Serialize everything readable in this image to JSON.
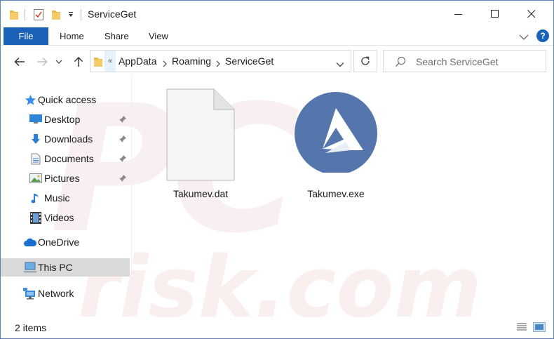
{
  "window": {
    "title": "ServiceGet",
    "accent": "#1a62b8"
  },
  "ribbon": {
    "file_label": "File",
    "tabs": [
      "Home",
      "Share",
      "View"
    ]
  },
  "address": {
    "overflow_marker": "«",
    "crumbs": [
      "AppData",
      "Roaming",
      "ServiceGet"
    ]
  },
  "search": {
    "placeholder": "Search ServiceGet"
  },
  "sidebar": {
    "quick_access": "Quick access",
    "items": [
      {
        "label": "Desktop",
        "icon": "desktop-icon",
        "pinned": true
      },
      {
        "label": "Downloads",
        "icon": "download-icon",
        "pinned": true
      },
      {
        "label": "Documents",
        "icon": "document-icon",
        "pinned": true
      },
      {
        "label": "Pictures",
        "icon": "picture-icon",
        "pinned": true
      },
      {
        "label": "Music",
        "icon": "music-icon",
        "pinned": false
      },
      {
        "label": "Videos",
        "icon": "video-icon",
        "pinned": false
      }
    ],
    "onedrive": "OneDrive",
    "this_pc": "This PC",
    "network": "Network"
  },
  "files": [
    {
      "name": "Takumev.dat",
      "icon": "blank-file-icon"
    },
    {
      "name": "Takumev.exe",
      "icon": "app-logo-icon"
    }
  ],
  "status": {
    "item_count": "2 items"
  }
}
